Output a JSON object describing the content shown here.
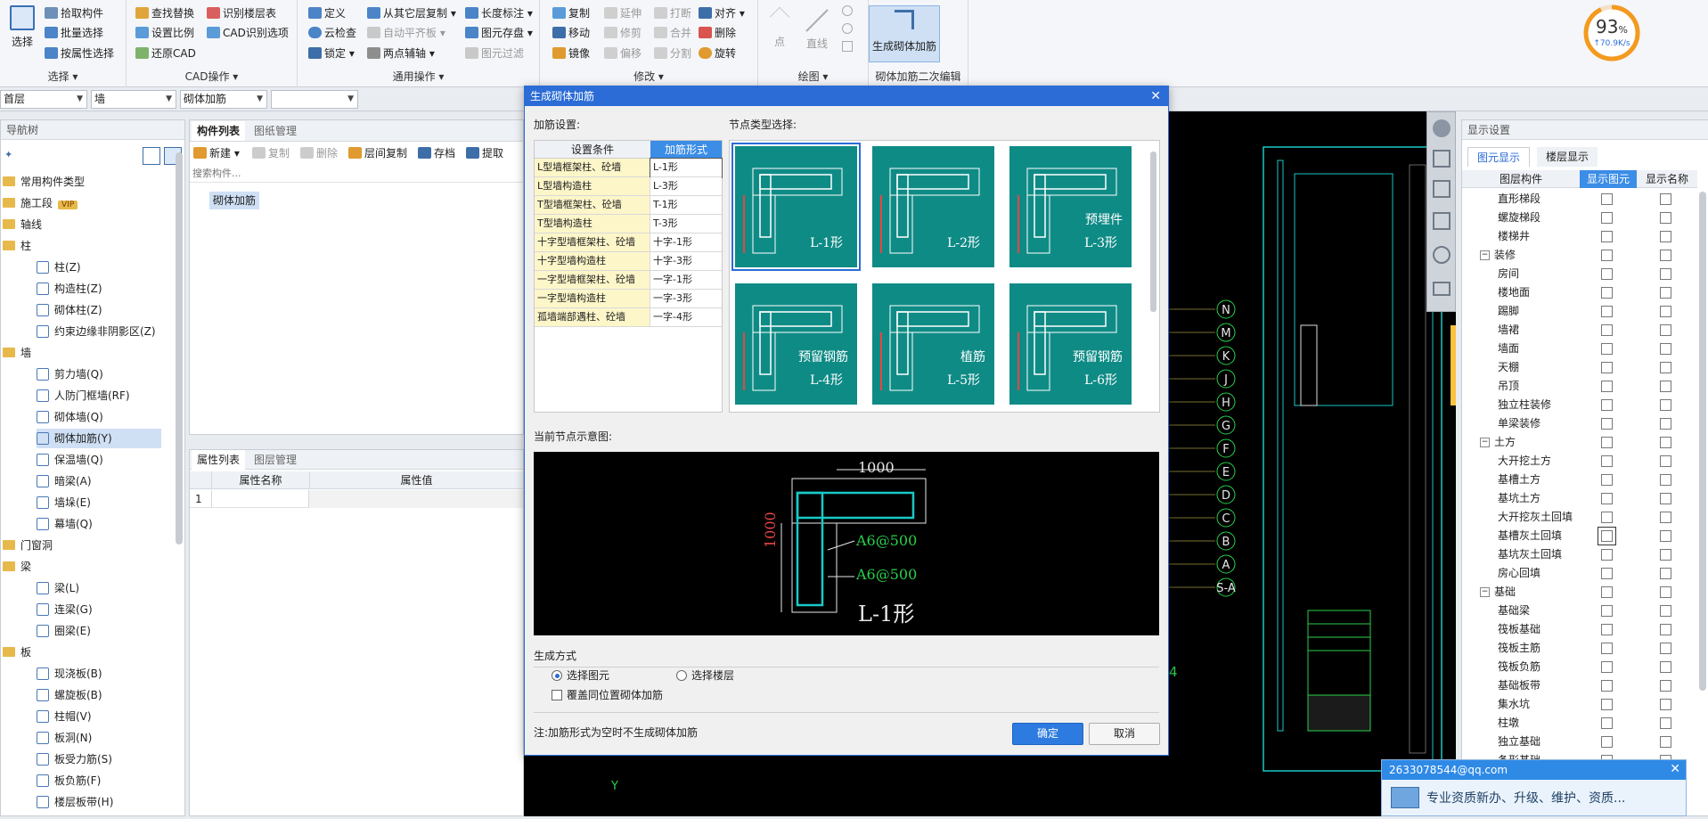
{
  "ribbon": {
    "select": {
      "big": "选择",
      "items": [
        "拾取构件",
        "批量选择",
        "按属性选择"
      ],
      "label": "选择 ▾"
    },
    "cad": {
      "items": [
        "查找替换",
        "设置比例",
        "还原CAD",
        "识别楼层表",
        "CAD识别选项"
      ],
      "label": "CAD操作 ▾"
    },
    "general": {
      "items": [
        "定义",
        "云检查",
        "锁定 ▾",
        "从其它层复制 ▾",
        "自动平齐板 ▾",
        "两点辅轴 ▾",
        "长度标注 ▾",
        "图元存盘 ▾",
        "图元过滤"
      ],
      "label": "通用操作 ▾"
    },
    "modify": {
      "items": [
        "复制",
        "移动",
        "镜像",
        "延伸",
        "修剪",
        "偏移",
        "打断",
        "合并",
        "分割",
        "对齐 ▾",
        "删除",
        "旋转"
      ],
      "label": "修改 ▾"
    },
    "draw": {
      "items": [
        "点",
        "直线"
      ],
      "label": "绘图 ▾"
    },
    "masonry": {
      "big": "生成砌体加筋",
      "label": "砌体加筋二次编辑"
    }
  },
  "speed": {
    "percent": "93",
    "unit": "%",
    "rate": "↑70.9K/s",
    "value": 93
  },
  "toolrow": {
    "floor": "首层",
    "type": "墙",
    "sub": "砌体加筋",
    "empty": ""
  },
  "nav": {
    "title": "导航树",
    "items": [
      {
        "t": "常用构件类型",
        "lvl": 0
      },
      {
        "t": "施工段",
        "lvl": 0,
        "badge": "VIP"
      },
      {
        "t": "轴线",
        "lvl": 0
      },
      {
        "t": "柱",
        "lvl": 0
      },
      {
        "t": "柱(Z)",
        "lvl": 1
      },
      {
        "t": "构造柱(Z)",
        "lvl": 1
      },
      {
        "t": "砌体柱(Z)",
        "lvl": 1
      },
      {
        "t": "约束边缘非阴影区(Z)",
        "lvl": 1
      },
      {
        "t": "墙",
        "lvl": 0
      },
      {
        "t": "剪力墙(Q)",
        "lvl": 1
      },
      {
        "t": "人防门框墙(RF)",
        "lvl": 1
      },
      {
        "t": "砌体墙(Q)",
        "lvl": 1
      },
      {
        "t": "砌体加筋(Y)",
        "lvl": 1,
        "sel": true
      },
      {
        "t": "保温墙(Q)",
        "lvl": 1
      },
      {
        "t": "暗梁(A)",
        "lvl": 1
      },
      {
        "t": "墙垛(E)",
        "lvl": 1
      },
      {
        "t": "幕墙(Q)",
        "lvl": 1
      },
      {
        "t": "门窗洞",
        "lvl": 0
      },
      {
        "t": "梁",
        "lvl": 0
      },
      {
        "t": "梁(L)",
        "lvl": 1
      },
      {
        "t": "连梁(G)",
        "lvl": 1
      },
      {
        "t": "圈梁(E)",
        "lvl": 1
      },
      {
        "t": "板",
        "lvl": 0
      },
      {
        "t": "现浇板(B)",
        "lvl": 1
      },
      {
        "t": "螺旋板(B)",
        "lvl": 1
      },
      {
        "t": "柱帽(V)",
        "lvl": 1
      },
      {
        "t": "板洞(N)",
        "lvl": 1
      },
      {
        "t": "板受力筋(S)",
        "lvl": 1
      },
      {
        "t": "板负筋(F)",
        "lvl": 1
      },
      {
        "t": "楼层板带(H)",
        "lvl": 1
      }
    ]
  },
  "comp": {
    "tabs": [
      "构件列表",
      "图纸管理"
    ],
    "tools": [
      "新建 ▾",
      "复制",
      "删除",
      "层间复制",
      "存档",
      "提取"
    ],
    "search_ph": "搜索构件...",
    "item": "砌体加筋"
  },
  "props": {
    "tabs": [
      "属性列表",
      "图层管理"
    ],
    "cols": [
      "属性名称",
      "属性值"
    ],
    "row1": "1"
  },
  "dialog": {
    "title": "生成砌体加筋",
    "rebar_label": "加筋设置:",
    "node_label": "节点类型选择:",
    "cols": [
      "设置条件",
      "加筋形式"
    ],
    "rows": [
      [
        "L型墙框架柱、砼墙",
        "L-1形"
      ],
      [
        "L型墙构造柱",
        "L-3形"
      ],
      [
        "T型墙框架柱、砼墙",
        "T-1形"
      ],
      [
        "T型墙构造柱",
        "T-3形"
      ],
      [
        "十字型墙框架柱、砼墙",
        "十字-1形"
      ],
      [
        "十字型墙构造柱",
        "十字-3形"
      ],
      [
        "一字型墙框架柱、砼墙",
        "一字-1形"
      ],
      [
        "一字型墙构造柱",
        "一字-3形"
      ],
      [
        "孤墙端部遇柱、砼墙",
        "一字-4形"
      ]
    ],
    "tiles": [
      {
        "name": "L-1形",
        "sub": "",
        "sel": true
      },
      {
        "name": "L-2形",
        "sub": ""
      },
      {
        "name": "L-3形",
        "sub": "预埋件"
      },
      {
        "name": "L-4形",
        "sub": "预留钢筋"
      },
      {
        "name": "L-5形",
        "sub": "植筋"
      },
      {
        "name": "L-6形",
        "sub": "预留钢筋"
      }
    ],
    "preview_label": "当前节点示意图:",
    "preview": {
      "dim_top": "1000",
      "dim_left": "1000",
      "rebar1": "A6@500",
      "rebar2": "A6@500",
      "shape": "L-1形"
    },
    "gen_label": "生成方式",
    "opt1": "选择图元",
    "opt2": "选择楼层",
    "opt3": "覆盖同位置砌体加筋",
    "note": "注:加筋形式为空时不生成砌体加筋",
    "ok": "确定",
    "cancel": "取消"
  },
  "cad": {
    "axis": [
      "N",
      "M",
      "K",
      "J",
      "H",
      "G",
      "F",
      "E",
      "D",
      "C",
      "B",
      "A",
      "S-A"
    ],
    "num": "4",
    "y": "Y"
  },
  "display": {
    "title": "显示设置",
    "tabs": [
      "图元显示",
      "楼层显示"
    ],
    "cols": [
      "图层构件",
      "显示图元",
      "显示名称"
    ],
    "rows": [
      {
        "t": "直形梯段",
        "l": 2
      },
      {
        "t": "螺旋梯段",
        "l": 2
      },
      {
        "t": "楼梯井",
        "l": 2
      },
      {
        "t": "装修",
        "l": 1
      },
      {
        "t": "房间",
        "l": 2
      },
      {
        "t": "楼地面",
        "l": 2
      },
      {
        "t": "踢脚",
        "l": 2
      },
      {
        "t": "墙裙",
        "l": 2
      },
      {
        "t": "墙面",
        "l": 2
      },
      {
        "t": "天棚",
        "l": 2
      },
      {
        "t": "吊顶",
        "l": 2
      },
      {
        "t": "独立柱装修",
        "l": 2
      },
      {
        "t": "单梁装修",
        "l": 2
      },
      {
        "t": "土方",
        "l": 1
      },
      {
        "t": "大开挖土方",
        "l": 2
      },
      {
        "t": "基槽土方",
        "l": 2
      },
      {
        "t": "基坑土方",
        "l": 2
      },
      {
        "t": "大开挖灰土回填",
        "l": 2
      },
      {
        "t": "基槽灰土回填",
        "l": 2,
        "sel": true
      },
      {
        "t": "基坑灰土回填",
        "l": 2
      },
      {
        "t": "房心回填",
        "l": 2
      },
      {
        "t": "基础",
        "l": 1
      },
      {
        "t": "基础梁",
        "l": 2
      },
      {
        "t": "筏板基础",
        "l": 2
      },
      {
        "t": "筏板主筋",
        "l": 2
      },
      {
        "t": "筏板负筋",
        "l": 2
      },
      {
        "t": "基础板带",
        "l": 2
      },
      {
        "t": "集水坑",
        "l": 2
      },
      {
        "t": "柱墩",
        "l": 2
      },
      {
        "t": "独立基础",
        "l": 2
      },
      {
        "t": "条形基础",
        "l": 2
      }
    ]
  },
  "qq": {
    "email": "2633078544@qq.com",
    "msg": "专业资质新办、升级、维护、资质..."
  }
}
